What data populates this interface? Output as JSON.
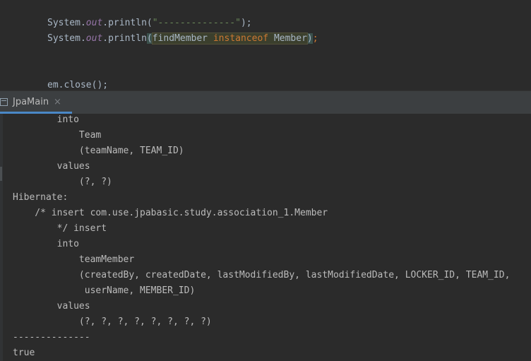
{
  "editor": {
    "line1": {
      "receiver": "System.",
      "field": "out",
      "method": ".println(",
      "string": "\"--------------\"",
      "tail": ");"
    },
    "line2": {
      "receiver": "System.",
      "field": "out",
      "method": ".println",
      "open_paren": "(",
      "var": "findMember",
      "keyword": "instanceof",
      "type": "Member",
      "close_paren": ")",
      "semicolon": ";"
    },
    "line3": {
      "text": "em.close();"
    }
  },
  "tool_window": {
    "tab_label": "JpaMain",
    "close_glyph": "×"
  },
  "console": {
    "lines": [
      "        into",
      "            Team",
      "            (teamName, TEAM_ID)",
      "        values",
      "            (?, ?)",
      "Hibernate:",
      "    /* insert com.use.jpabasic.study.association_1.Member",
      "        */ insert",
      "        into",
      "            teamMember",
      "            (createdBy, createdDate, lastModifiedBy, lastModifiedDate, LOCKER_ID, TEAM_ID,",
      "             userName, MEMBER_ID)",
      "        values",
      "            (?, ?, ?, ?, ?, ?, ?, ?)",
      "--------------",
      "true"
    ]
  }
}
